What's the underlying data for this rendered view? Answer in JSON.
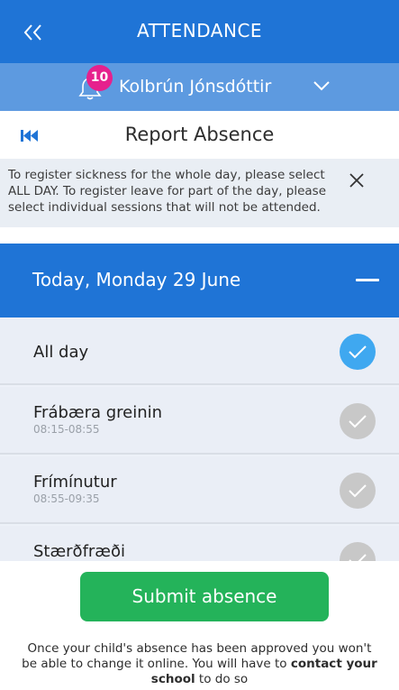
{
  "header": {
    "title": "ATTENDANCE",
    "back_icon": "double-chevron-left-icon"
  },
  "user_bar": {
    "notification_count": "10",
    "name": "Kolbrún Jónsdóttir",
    "dropdown_icon": "chevron-down-icon"
  },
  "subheader": {
    "title": "Report Absence",
    "first_icon": "skip-to-first-icon"
  },
  "notice": {
    "text": "To register sickness for the whole day, please select ALL DAY. To register leave for part of the day, please select individual sessions that will not be attended."
  },
  "day": {
    "title": "Today, Monday 29 June"
  },
  "sessions": [
    {
      "title": "All day",
      "time": "",
      "selected": true
    },
    {
      "title": "Frábæra greinin",
      "time": "08:15-08:55",
      "selected": false
    },
    {
      "title": "Frímínutur",
      "time": "08:55-09:35",
      "selected": false
    },
    {
      "title": "Stærðfræði",
      "time": "",
      "selected": false
    }
  ],
  "submit": {
    "label": "Submit absence"
  },
  "footer": {
    "text_before": "Once your child's absence has been approved you won't be able to change it online. You will have to ",
    "text_bold": "contact your school",
    "text_after": " to do so"
  },
  "colors": {
    "header_blue": "#1f74d6",
    "user_bar_blue": "#5d9ae0",
    "badge_pink": "#e6218d",
    "selected_check": "#3fa8f0",
    "unselected_check": "#c8c8c8",
    "submit_green": "#24b35a"
  }
}
